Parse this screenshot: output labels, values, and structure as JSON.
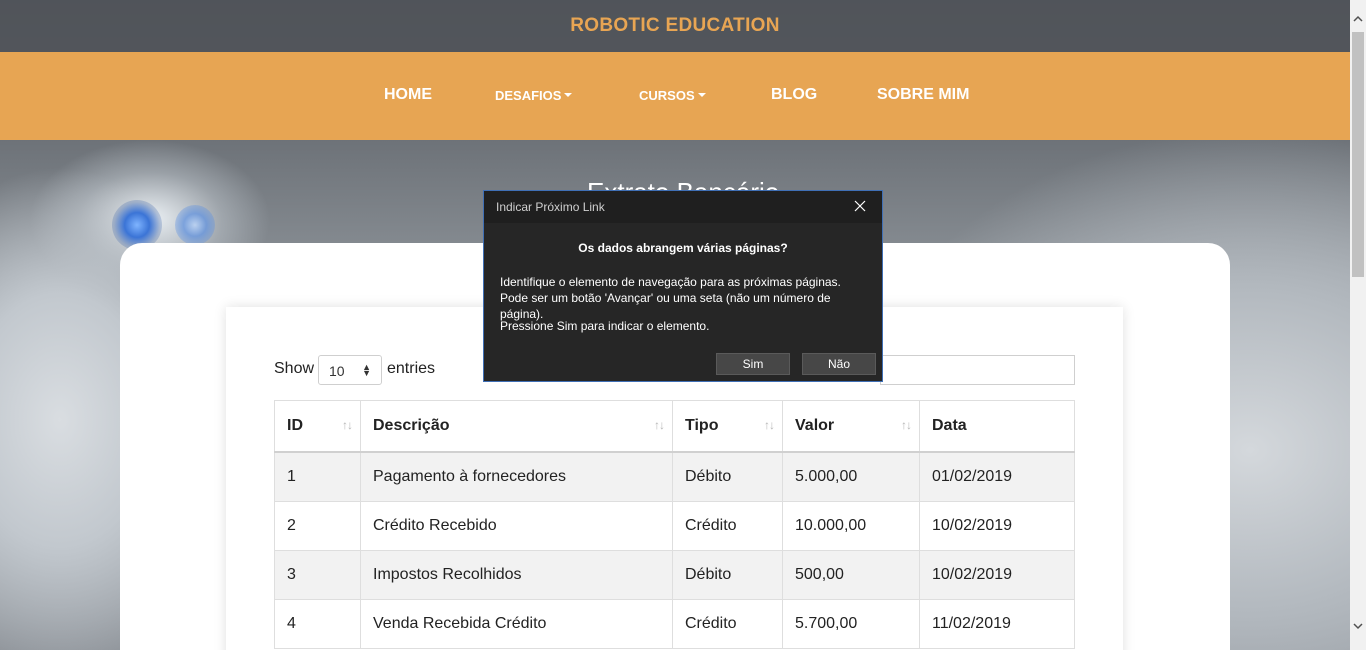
{
  "header": {
    "site_title": "ROBOTIC EDUCATION"
  },
  "nav": {
    "items": [
      {
        "label": "HOME"
      },
      {
        "label": "DESAFIOS"
      },
      {
        "label": "CURSOS"
      },
      {
        "label": "BLOG"
      },
      {
        "label": "SOBRE MIM"
      }
    ]
  },
  "page": {
    "heading": "Extrato Bancário"
  },
  "datatable": {
    "show_label": "Show",
    "entries_value": "10",
    "entries_label": "entries",
    "columns": [
      "ID",
      "Descrição",
      "Tipo",
      "Valor",
      "Data"
    ],
    "rows": [
      [
        "1",
        "Pagamento à fornecedores",
        "Débito",
        "5.000,00",
        "01/02/2019"
      ],
      [
        "2",
        "Crédito Recebido",
        "Crédito",
        "10.000,00",
        "10/02/2019"
      ],
      [
        "3",
        "Impostos Recolhidos",
        "Débito",
        "500,00",
        "10/02/2019"
      ],
      [
        "4",
        "Venda Recebida Crédito",
        "Crédito",
        "5.700,00",
        "11/02/2019"
      ]
    ]
  },
  "dialog": {
    "title": "Indicar Próximo Link",
    "heading": "Os dados abrangem várias páginas?",
    "body": "Identifique o elemento de navegação para as próximas páginas. Pode ser um botão 'Avançar' ou uma seta (não um número de página).",
    "note": "Pressione Sim para indicar o elemento.",
    "yes_label": "Sim",
    "no_label": "Não"
  },
  "colors": {
    "accent": "#e7a553",
    "title": "#e8a553",
    "dialog_bg": "#262626"
  },
  "icons": {
    "sort": "sort-arrows-icon",
    "close": "close-icon",
    "scroll_up": "chevron-up-icon",
    "scroll_down": "chevron-down-icon"
  }
}
